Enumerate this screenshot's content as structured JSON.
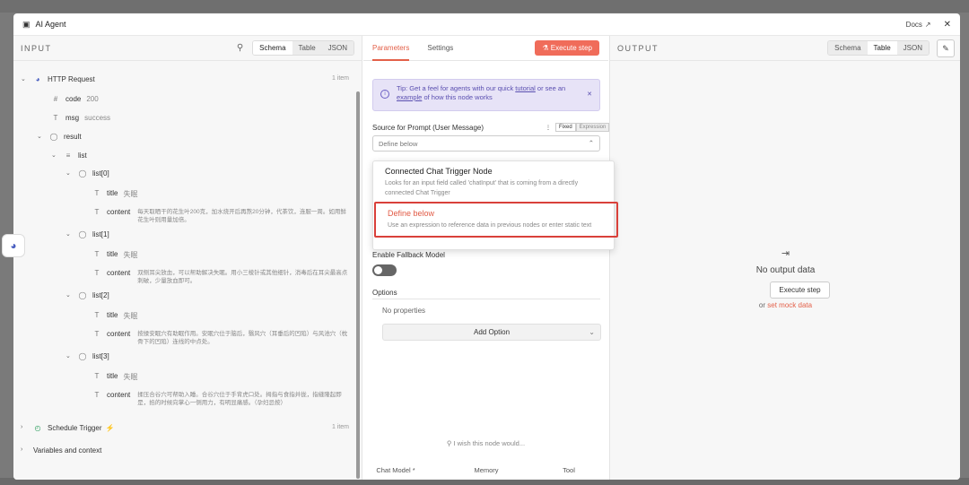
{
  "window": {
    "title": "AI Agent",
    "docs_label": "Docs",
    "close_label": "✕"
  },
  "input": {
    "label": "INPUT",
    "views": [
      "Schema",
      "Table",
      "JSON"
    ],
    "active_view": "Schema",
    "http_request": {
      "name": "HTTP Request",
      "count": "1 item"
    },
    "fields": {
      "code_key": "code",
      "code_value": "200",
      "msg_key": "msg",
      "msg_value": "success",
      "result_key": "result",
      "list_key": "list"
    },
    "items": [
      {
        "label": "list[0]",
        "title_key": "title",
        "title_value": "失眠",
        "content_key": "content",
        "content_value": "每天取晒干的花生叶200克，加水烧开后再熬20分钟，代茶饮，连服一周。如用鲜花生叶则用量加倍。"
      },
      {
        "label": "list[1]",
        "title_key": "title",
        "title_value": "失眠",
        "content_key": "content",
        "content_value": "双侧耳尖放血，可以帮助解决失眠。用小三棱针或其他细针，消毒后在耳尖最高点刺破，少量放血即可。"
      },
      {
        "label": "list[2]",
        "title_key": "title",
        "title_value": "失眠",
        "content_key": "content",
        "content_value": "按揉安眠穴有助眠作用。安眠穴位于脑后，翳风穴（耳垂后的凹陷）与风池穴（枕骨下的凹陷）连线的中点处。"
      },
      {
        "label": "list[3]",
        "title_key": "title",
        "title_value": "失眠",
        "content_key": "content",
        "content_value": "揉压合谷穴可帮助入睡。合谷穴位于手背虎口处。拇指与食指并拢，指缝隆起即是，掐的时候向掌心一侧用力，有明显痛感。（孕妇忌按）"
      }
    ],
    "schedule_trigger": {
      "name": "Schedule Trigger",
      "count": "1 item"
    },
    "variables": "Variables and context"
  },
  "params": {
    "tabs": [
      "Parameters",
      "Settings"
    ],
    "active_tab": "Parameters",
    "execute_label": "Execute step",
    "tip": {
      "prefix": "Tip: Get a feel for agents with our quick ",
      "link1": "tutorial",
      "middle": " or see an ",
      "link2": "example",
      "suffix": " of how this node works"
    },
    "source_label": "Source for Prompt (User Message)",
    "fixed_label": "Fixed",
    "expression_label": "Expression",
    "select_value": "Define below",
    "options": [
      {
        "title": "Connected Chat Trigger Node",
        "desc": "Looks for an input field called 'chatInput' that is coming from a directly connected Chat Trigger"
      },
      {
        "title": "Define below",
        "desc": "Use an expression to reference data in previous nodes or enter static text"
      }
    ],
    "fallback_label": "Enable Fallback Model",
    "fallback_enabled": false,
    "options_label": "Options",
    "no_properties": "No properties",
    "add_option": "Add Option",
    "wish": "I wish this node would...",
    "bottom": [
      "Chat Model *",
      "Memory",
      "Tool"
    ]
  },
  "output": {
    "label": "OUTPUT",
    "views": [
      "Schema",
      "Table",
      "JSON"
    ],
    "active_view": "Table",
    "no_output": "No output data",
    "execute_label": "Execute step",
    "or_label": "or",
    "mock_label": "set mock data"
  },
  "colors": {
    "accent": "#e36049",
    "tip_bg": "#e7e3f7",
    "selected_border": "#d9403a"
  }
}
